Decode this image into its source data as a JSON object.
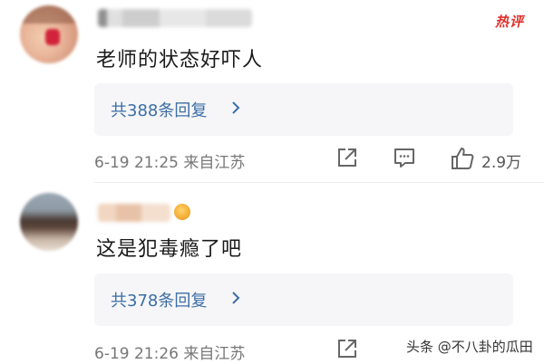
{
  "comments": [
    {
      "badge": "热评",
      "text": "老师的状态好吓人",
      "reply_label": "共388条回复",
      "reply_chevron": ">",
      "meta": "6-19 21:25 来自江苏",
      "likes": "2.9万",
      "icons": [
        "share-icon",
        "comment-icon",
        "like-icon"
      ]
    },
    {
      "text": "这是犯毒瘾了吧",
      "reply_label": "共378条回复",
      "reply_chevron": ">",
      "meta": "6-19 21:26 来自江苏",
      "icons": [
        "share-icon"
      ]
    }
  ],
  "watermark": "头条 @不八卦的瓜田",
  "colors": {
    "link": "#3c6ea6",
    "hot": "#e0302b",
    "reply_bg": "#f6f6f8",
    "meta": "#777777"
  }
}
